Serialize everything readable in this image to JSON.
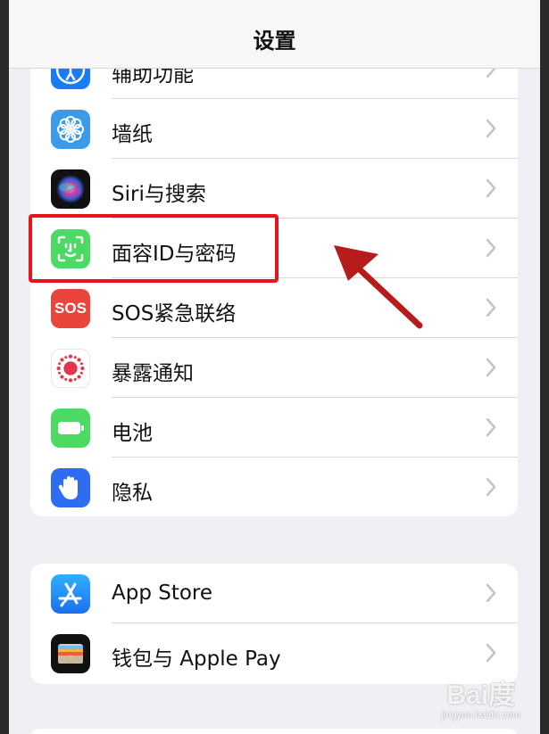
{
  "app": {
    "title": "设置"
  },
  "groups": [
    {
      "items": [
        {
          "label": "辅助功能",
          "icon": "accessibility-icon",
          "color": "#1a7cf5"
        },
        {
          "label": "墙纸",
          "icon": "wallpaper-flower-icon",
          "color": "#3b9be8"
        },
        {
          "label": "Siri与搜索",
          "icon": "siri-icon",
          "color": "#111111"
        },
        {
          "label": "面容ID与密码",
          "icon": "face-id-icon",
          "color": "#4cd964"
        },
        {
          "label": "SOS紧急联络",
          "icon": "sos-icon",
          "color": "#e9453a",
          "icon_text": "SOS"
        },
        {
          "label": "暴露通知",
          "icon": "exposure-notification-icon",
          "color": "#ffffff"
        },
        {
          "label": "电池",
          "icon": "battery-icon",
          "color": "#4cd964"
        },
        {
          "label": "隐私",
          "icon": "privacy-hand-icon",
          "color": "#2f6df0"
        }
      ]
    },
    {
      "items": [
        {
          "label": "App Store",
          "icon": "app-store-icon",
          "color": "#1a8cff"
        },
        {
          "label": "钱包与 Apple Pay",
          "icon": "wallet-icon",
          "color": "#111111"
        }
      ]
    }
  ],
  "annotation": {
    "highlight_color": "#e8141b",
    "arrow_color": "#b71c1c"
  },
  "watermark": {
    "brand": "Bai度",
    "sub": "jingyan.baidu.com"
  }
}
